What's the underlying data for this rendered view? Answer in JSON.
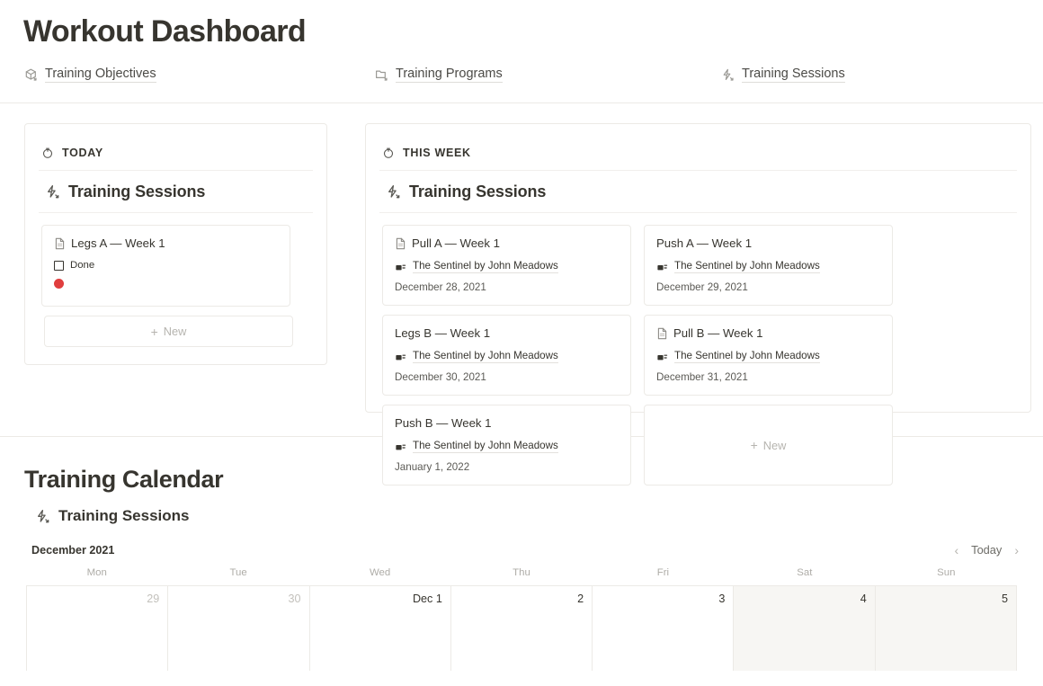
{
  "header": {
    "title": "Workout Dashboard",
    "nav": [
      {
        "label": "Training Objectives",
        "icon": "cube-icon"
      },
      {
        "label": "Training Programs",
        "icon": "folder-arrow-icon"
      },
      {
        "label": "Training Sessions",
        "icon": "bolt-icon"
      }
    ]
  },
  "today_panel": {
    "section_label": "TODAY",
    "section_icon": "clock-icon",
    "database_title": "Training Sessions",
    "database_icon": "bolt-icon",
    "cards": [
      {
        "title": "Legs A — Week 1",
        "title_icon": "document-icon",
        "checkbox_label": "Done",
        "checkbox_checked": false,
        "status_color": "#e03e3e"
      }
    ],
    "new_label": "New",
    "new_plus": "+"
  },
  "week_panel": {
    "section_label": "THIS WEEK",
    "section_icon": "clock-icon",
    "database_title": "Training Sessions",
    "database_icon": "bolt-icon",
    "cards": [
      {
        "title": "Pull A — Week 1",
        "has_doc_icon": true,
        "relation": "The Sentinel by John Meadows",
        "relation_icon": "relation-icon",
        "date": "December 28, 2021"
      },
      {
        "title": "Push A — Week 1",
        "has_doc_icon": false,
        "relation": "The Sentinel by John Meadows",
        "relation_icon": "relation-icon",
        "date": "December 29, 2021"
      },
      {
        "title": "Legs B — Week 1",
        "has_doc_icon": false,
        "relation": "The Sentinel by John Meadows",
        "relation_icon": "relation-icon",
        "date": "December 30, 2021"
      },
      {
        "title": "Pull B — Week 1",
        "has_doc_icon": true,
        "relation": "The Sentinel by John Meadows",
        "relation_icon": "relation-icon",
        "date": "December 31, 2021"
      },
      {
        "title": "Push B — Week 1",
        "has_doc_icon": false,
        "relation": "The Sentinel by John Meadows",
        "relation_icon": "relation-icon",
        "date": "January 1, 2022"
      }
    ],
    "new_label": "New",
    "new_plus": "+"
  },
  "calendar": {
    "heading": "Training Calendar",
    "database_title": "Training Sessions",
    "database_icon": "bolt-icon",
    "month_label": "December 2021",
    "today_label": "Today",
    "prev_icon": "chevron-left-icon",
    "next_icon": "chevron-right-icon",
    "day_names": [
      "Mon",
      "Tue",
      "Wed",
      "Thu",
      "Fri",
      "Sat",
      "Sun"
    ],
    "cells": [
      {
        "label": "29",
        "current_month": false,
        "weekend": false
      },
      {
        "label": "30",
        "current_month": false,
        "weekend": false
      },
      {
        "label": "Dec 1",
        "current_month": true,
        "weekend": false
      },
      {
        "label": "2",
        "current_month": true,
        "weekend": false
      },
      {
        "label": "3",
        "current_month": true,
        "weekend": false
      },
      {
        "label": "4",
        "current_month": true,
        "weekend": true
      },
      {
        "label": "5",
        "current_month": true,
        "weekend": true
      }
    ]
  }
}
